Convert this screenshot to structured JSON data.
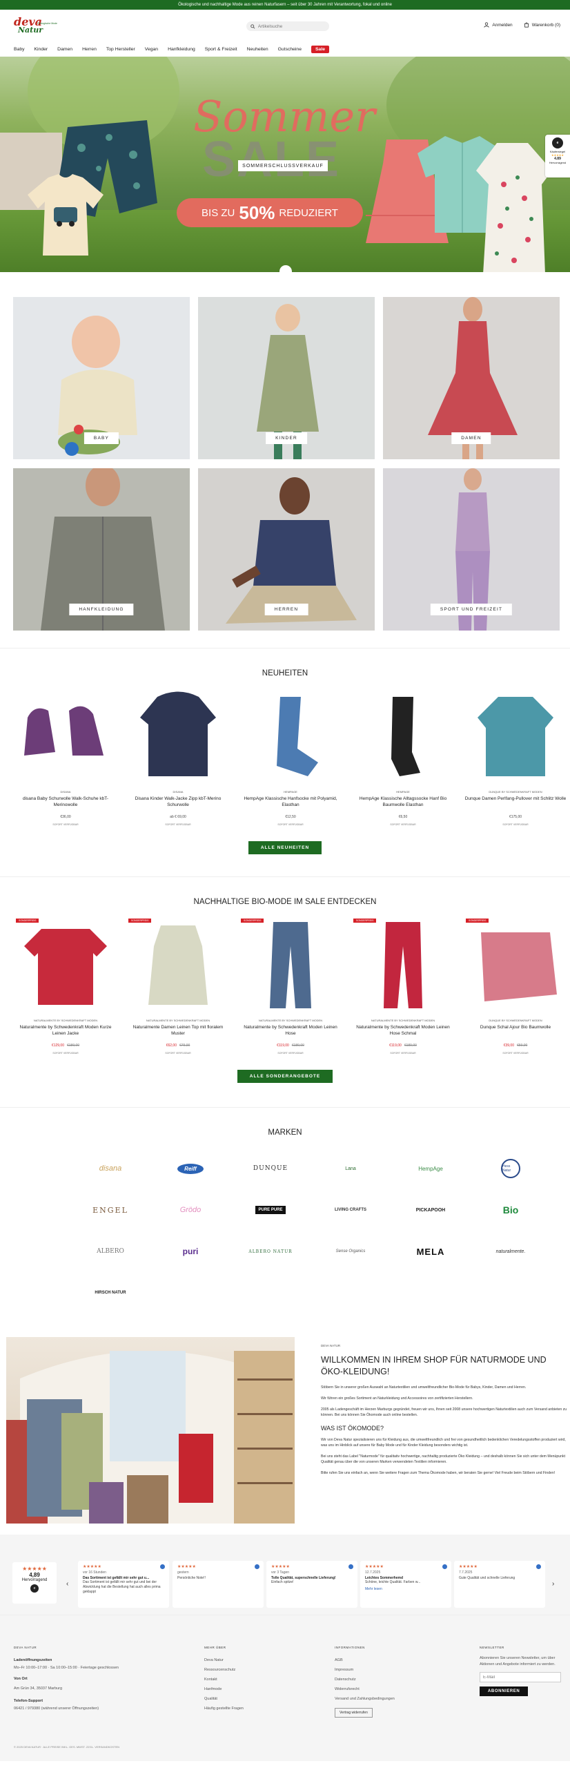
{
  "topbar": {
    "text": "Ökologische und nachhaltige Mode aus reinen Naturfasern – seit über 30 Jahren mit Verantwortung, fokal und online"
  },
  "logo": {
    "line1": "deva",
    "line2": "Natur",
    "tagline": "Ökologische Mode"
  },
  "search": {
    "placeholder": "Artikelsuche"
  },
  "header": {
    "login": "Anmelden",
    "cart": "Warenkorb (0)"
  },
  "nav": [
    "Baby",
    "Kinder",
    "Damen",
    "Herren",
    "Top Hersteller",
    "Vegan",
    "Hanfkleidung",
    "Sport & Freizeit",
    "Neuheiten",
    "Gutscheine"
  ],
  "nav_sale": "Sale",
  "hero": {
    "title1": "Sommer",
    "title2": "SALE",
    "ribbon": "SOMMERSCHLUSSVERKAUF",
    "banner_pre": "BIS ZU",
    "banner_pct": "50%",
    "banner_post": "REDUZIERT"
  },
  "trusted_badge": {
    "logo": "e",
    "label": "Käufersiegel",
    "rating": "4.89",
    "sub": "Hervorragend"
  },
  "categories": [
    "BABY",
    "KINDER",
    "DAMEN",
    "HANFKLEIDUNG",
    "HERREN",
    "SPORT UND FREIZEIT"
  ],
  "neuheiten": {
    "title": "NEUHEITEN",
    "button": "ALLE NEUHEITEN",
    "products": [
      {
        "brand": "disana",
        "name": "disana Baby Schurwolle Walk-Schuhe kbT-Merinowolle",
        "price": "€36,00",
        "stock": "SOFORT VERFÜGBAR",
        "color": "#6c3d78"
      },
      {
        "brand": "disana",
        "name": "Disana Kinder Walk-Jacke Zipp kbT-Merino Schurwolle",
        "price": "ab € 69,00",
        "stock": "SOFORT VERFÜGBAR",
        "color": "#2d3552"
      },
      {
        "brand": "HempAge",
        "name": "HempAge Klassische Hanfsocke mit Polyamid, Elasthan",
        "price": "€12,50",
        "stock": "SOFORT VERFÜGBAR",
        "color": "#4c7bb2"
      },
      {
        "brand": "HempAge",
        "name": "HempAge Klassische Alltagssocke Hanf Bio Baumwolle Elasthan",
        "price": "€6,50",
        "stock": "SOFORT VERFÜGBAR",
        "color": "#222"
      },
      {
        "brand": "Dunque by Schwedenkraft Moden",
        "name": "Dunque Damen Perlfang-Pullover mit Schlitz Wolle",
        "price": "€175,00",
        "stock": "SOFORT VERFÜGBAR",
        "color": "#4c98a8"
      }
    ]
  },
  "sale_section": {
    "title": "NACHHALTIGE BIO-MODE IM SALE ENTDECKEN",
    "button": "ALLE SONDERANGEBOTE",
    "badge": "SONDERPREIS",
    "products": [
      {
        "brand": "Naturalmente by Schwedenkraft Moden",
        "name": "Naturalmente by Schwedenkraft Moden Kurze Leinen Jacke",
        "sale": "€129,00",
        "old": "€189,00",
        "stock": "SOFORT VERFÜGBAR",
        "color": "#c72a3c"
      },
      {
        "brand": "Naturalmente by Schwedenkraft Moden",
        "name": "Naturalmente Damen Leinen Top mit floralem Muster",
        "sale": "€62,00",
        "old": "€79,00",
        "stock": "SOFORT VERFÜGBAR",
        "color": "#d8d9c4"
      },
      {
        "brand": "Naturalmente by Schwedenkraft Moden",
        "name": "Naturalmente by Schwedenkraft Moden Leinen Hose",
        "sale": "€119,00",
        "old": "€189,00",
        "stock": "SOFORT VERFÜGBAR",
        "color": "#4e6a8f"
      },
      {
        "brand": "Naturalmente by Schwedenkraft Moden",
        "name": "Naturalmente by Schwedenkraft Moden Leinen Hose Schmal",
        "sale": "€119,00",
        "old": "€189,00",
        "stock": "SOFORT VERFÜGBAR",
        "color": "#c2263e"
      },
      {
        "brand": "Dunque by Schwedenkraft Moden",
        "name": "Dunque Schal Ajour Bio Baumwolle",
        "sale": "€39,00",
        "old": "€59,00",
        "stock": "SOFORT VERFÜGBAR",
        "color": "#d77b8a"
      }
    ]
  },
  "marken": {
    "title": "MARKEN",
    "brands": [
      "disana",
      "Reiff",
      "DUNQUE",
      "Lana",
      "HempAge",
      "Hess Natur",
      "ENGEL",
      "Grödo",
      "PURE PURE",
      "LIVING CRAFTS",
      "PICKAPOOH",
      "Bio",
      "ALBERO",
      "puri",
      "ALBERO NATUR",
      "Sense Organics",
      "MELA",
      "naturalmente.",
      "HIRSCH NATUR"
    ]
  },
  "welcome": {
    "kicker": "DEVA NATUR",
    "title": "WILLKOMMEN IN IHREM SHOP FÜR NATURMODE UND ÖKO-KLEIDUNG!",
    "p1": "Stöbern Sie in unserer großen Auswahl an Naturtextilien und umweltfreundlicher Bio-Mode für Babys, Kinder, Damen und Herren.",
    "p2": "Wir führen ein großes Sortiment an Naturkleidung und Accessoires von zertifizierten Herstellern.",
    "p3": "2005 als Ladengeschäft im Herzen Marburgs gegründet, freuen wir uns, Ihnen seit 2008 unsere hochwertigen Naturtextilien auch zum Versand anbieten zu können. Bei uns können Sie Ökomode auch online bestellen.",
    "h2": "WAS IST ÖKOMODE?",
    "p4": "Wir von Deva Natur spezialisieren uns für Kleidung aus, die umweltfreundlich und frei von gesundheitlich bedenklichen Veredelungsstoffen produziert wird, was uns im Hinblick auf unsere für Baby Mode und für Kinder Kleidung besonders wichtig ist.",
    "p5": "Bei uns steht das Label \"Naturmode\" für qualitativ hochwertige, nachhaltig produzierte Öko Kleidung – und deshalb können Sie sich unter dem Menüpunkt Qualität genau über die von unseren Marken verwendeten Textilien informieren.",
    "p6": "Bitte rufen Sie uns einfach an, wenn Sie weitere Fragen zum Thema Ökomode haben, wir beraten Sie gerne! Viel Freude beim Stöbern und Finden!"
  },
  "reviews": {
    "total_rating": "4,89",
    "total_label": "Hervorragend",
    "items": [
      {
        "date": "vor 16 Stunden",
        "title": "Das Sortiment ist gefällt mir sehr gut u...",
        "body": "Das Sortiment ist gefällt mir sehr gut und bei der Abwicklung hat die Bestellung hat auch alles prima geklappt",
        "more": ""
      },
      {
        "date": "gestern",
        "title": "",
        "body": "Persönliche Note!!",
        "more": ""
      },
      {
        "date": "vor 3 Tagen",
        "title": "Tolle Qualität, superschnelle Lieferung!",
        "body": "Einfach spitze!",
        "more": ""
      },
      {
        "date": "12.7.2025",
        "title": "Leichtes Sommerhemd",
        "body": "Schöne, leichte Qualität. Farben w...",
        "more": "Mehr lesen"
      },
      {
        "date": "7.7.2025",
        "title": "",
        "body": "Gute Qualität und schnelle Lieferung",
        "more": ""
      }
    ]
  },
  "footer": {
    "col1_h": "DEVA NATUR",
    "hours_h": "Ladenöffnungszeiten",
    "hours": "Mo–Fr 10:00–17:00 · Sa 10:00–15:00 · Feiertage geschlossen",
    "addr_h": "Von Ort",
    "addr": "Am Grün 34, 35037 Marburg",
    "phone_h": "Telefon-Support",
    "phone": "06421 / 979380 (während unserer Öffnungszeiten)",
    "col2_h": "MEHR ÜBER",
    "col2": [
      "Deva Natur",
      "Ressourcenschutz",
      "Kontakt",
      "Hanfmode",
      "Qualität",
      "Häufig gestellte Fragen"
    ],
    "col3_h": "INFORMATIONEN",
    "col3": [
      "AGB",
      "Impressum",
      "Datenschutz",
      "Widerrufsrecht",
      "Versand und Zahlungsbedingungen"
    ],
    "col3_btn": "Vertrag widerrufen",
    "col4_h": "NEWSLETTER",
    "col4_text": "Abonnieren Sie unseren Newsletter, um über Aktionen und Angebote informiert zu werden.",
    "nl_placeholder": "E-Mail",
    "nl_btn": "ABONNIEREN",
    "copyright": "© 2025 DEVA NATUR · ALLE PREISE INKL. GES. MWST. ZZGL. VERSANDKOSTEN"
  }
}
